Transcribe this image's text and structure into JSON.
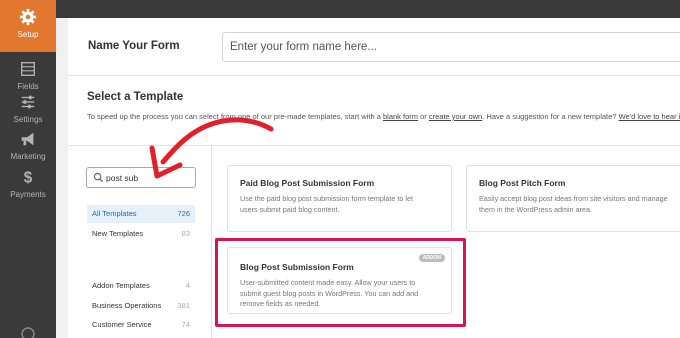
{
  "sidebar": {
    "items": [
      {
        "label": "Setup",
        "icon": "gear-icon",
        "active": true
      },
      {
        "label": "Fields",
        "icon": "fields-list-icon",
        "active": false
      },
      {
        "label": "Settings",
        "icon": "sliders-icon",
        "active": false
      },
      {
        "label": "Marketing",
        "icon": "megaphone-icon",
        "active": false
      },
      {
        "label": "Payments",
        "icon": "dollar-icon",
        "active": false
      }
    ]
  },
  "form_name": {
    "label": "Name Your Form",
    "placeholder": "Enter your form name here..."
  },
  "select_template": {
    "title": "Select a Template",
    "desc_prefix": "To speed up the process you can select from one of our pre-made templates, start with a ",
    "blank_form_link": "blank form",
    "or": " or ",
    "create_own_link": "create your own",
    "desc_suffix": ". Have a suggestion for a new template? ",
    "love_link": "We'd love to hear it!"
  },
  "search": {
    "value": "post sub"
  },
  "categories": [
    {
      "label": "All Templates",
      "count": "726",
      "active": true
    },
    {
      "label": "New Templates",
      "count": "83",
      "active": false
    },
    {
      "label": "Addon Templates",
      "count": "4",
      "active": false
    },
    {
      "label": "Business Operations",
      "count": "381",
      "active": false
    },
    {
      "label": "Customer Service",
      "count": "74",
      "active": false
    }
  ],
  "templates": [
    {
      "title": "Paid Blog Post Submission Form",
      "desc_lines": [
        "Use the paid blog post submission form template to let",
        "users submit paid blog content."
      ]
    },
    {
      "title": "Blog Post Pitch Form",
      "desc_lines": [
        "Easily accept blog post ideas from site visitors and manage",
        "them in the WordPress admin area."
      ]
    },
    {
      "title": "Blog Post Submission Form",
      "badge": "ADDON",
      "desc_lines": [
        "User-submitted content made easy. Allow your users to",
        "submit guest blog posts in WordPress. You can add and",
        "remove fields as needed."
      ]
    }
  ],
  "colors": {
    "sidebar_bg": "#3a3a3a",
    "active_orange": "#e27730",
    "highlight_border": "#d5145a",
    "arrow_red": "#e0202a",
    "link_blue": "#1a6eb1"
  }
}
